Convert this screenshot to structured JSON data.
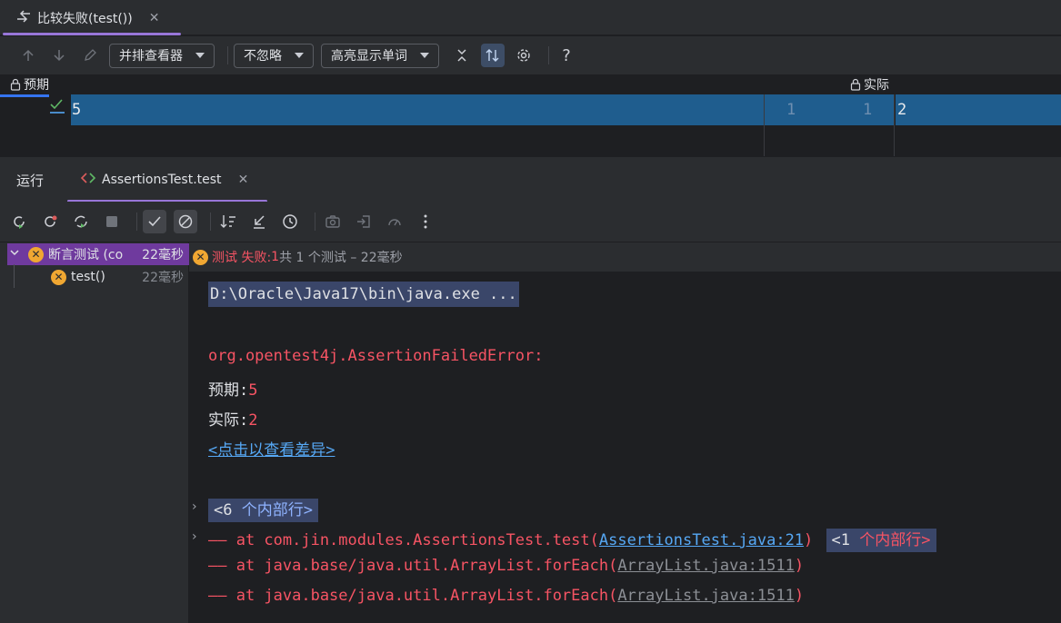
{
  "top_tab": {
    "title": "比较失败(test())",
    "close": "✕"
  },
  "diff_toolbar": {
    "viewer": "并排查看器",
    "ignore": "不忽略",
    "highlight": "高亮显示单词",
    "help": "?"
  },
  "diff": {
    "left_label": "预期",
    "right_label": "实际",
    "left_value": "5",
    "gutter_left_num": "1",
    "gutter_right_num": "1",
    "right_value": "2"
  },
  "run_panel": {
    "title": "运行",
    "tab_label": "AssertionsTest.test",
    "tab_close": "✕"
  },
  "tree": {
    "root_label": "断言测试 (co",
    "root_time": "22毫秒",
    "child_label": "test()",
    "child_time": "22毫秒"
  },
  "status": {
    "label": "测试 失败:",
    "count": "1",
    "summary": "共 1 个测试 – 22毫秒"
  },
  "console": {
    "command": "D:\\Oracle\\Java17\\bin\\java.exe ...",
    "error": "org.opentest4j.AssertionFailedError: ",
    "expected_label": "预期:",
    "expected_value": "5",
    "actual_label": "实际:",
    "actual_value": "2",
    "diff_link": "<点击以查看差异>",
    "fold1_num": "<6",
    "fold1_text": "个内部行>",
    "trace1_prefix": "—— at com.jin.modules.AssertionsTest.test(",
    "trace1_link": "AssertionsTest.java:21",
    "trace1_suffix": ")",
    "fold2_num": "<1",
    "fold2_text": "个内部行>",
    "trace2_prefix": "—— at java.base/java.util.ArrayList.forEach(",
    "trace2_link": "ArrayList.java:1511",
    "trace2_suffix": ")",
    "trace3_prefix": "—— at java.base/java.util.ArrayList.forEach(",
    "trace3_link": "ArrayList.java:1511",
    "trace3_suffix": ")"
  },
  "colors": {
    "accent": "#9876d8",
    "selection": "#1f5d8e",
    "error": "#f75464",
    "link": "#56a8f5",
    "warning": "#f0a732"
  }
}
